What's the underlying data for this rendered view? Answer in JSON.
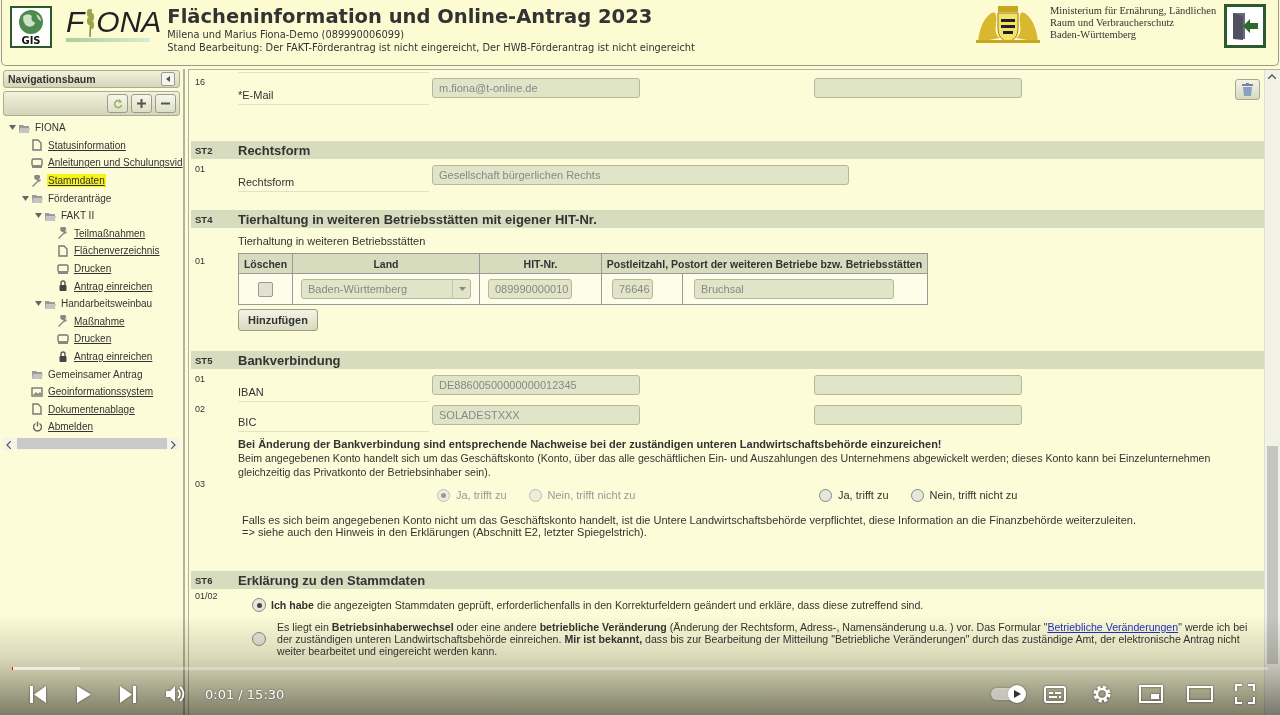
{
  "header": {
    "badge": "GIS",
    "logo": [
      "F",
      "ONA"
    ],
    "title": "Flächeninformation und Online-Antrag 2023",
    "user": "Milena und Marius Fiona-Demo (089990006099)",
    "status": "Stand Bearbeitung: Der FAKT-Förderantrag ist nicht eingereicht, Der HWB-Förderantrag ist nicht eingereicht",
    "ministry": [
      "Ministerium für Ernährung, Ländlichen",
      "Raum und Verbraucherschutz",
      "Baden-Württemberg"
    ]
  },
  "nav": {
    "title": "Navigationsbaum",
    "tree": [
      {
        "label": "FIONA",
        "kind": "folder",
        "expanded": true,
        "selected": false,
        "children": [
          {
            "label": "Statusinformation",
            "kind": "page",
            "selected": false
          },
          {
            "label": "Anleitungen und Schulungsvid",
            "kind": "print",
            "selected": false
          },
          {
            "label": "Stammdaten",
            "kind": "wrench",
            "selected": true
          },
          {
            "label": "Förderanträge",
            "kind": "folder",
            "expanded": true,
            "selected": false,
            "children": [
              {
                "label": "FAKT II",
                "kind": "folder",
                "expanded": true,
                "selected": false,
                "children": [
                  {
                    "label": "Teilmaßnahmen",
                    "kind": "wrench",
                    "selected": false
                  },
                  {
                    "label": "Flächenverzeichnis",
                    "kind": "page",
                    "selected": false
                  },
                  {
                    "label": "Drucken",
                    "kind": "print",
                    "selected": false
                  },
                  {
                    "label": "Antrag einreichen",
                    "kind": "lock",
                    "selected": false
                  }
                ]
              },
              {
                "label": "Handarbeitsweinbau",
                "kind": "folder",
                "expanded": true,
                "selected": false,
                "children": [
                  {
                    "label": "Maßnahme",
                    "kind": "wrench",
                    "selected": false
                  },
                  {
                    "label": "Drucken",
                    "kind": "print",
                    "selected": false
                  },
                  {
                    "label": "Antrag einreichen",
                    "kind": "lock",
                    "selected": false
                  }
                ]
              }
            ]
          },
          {
            "label": "Gemeinsamer Antrag",
            "kind": "folder",
            "selected": false
          },
          {
            "label": "Geoinformationssystem",
            "kind": "map",
            "selected": false
          },
          {
            "label": "Dokumentenablage",
            "kind": "page",
            "selected": false
          },
          {
            "label": "Abmelden",
            "kind": "power",
            "selected": false
          }
        ]
      }
    ]
  },
  "main": {
    "email_row": {
      "kind": "field",
      "number": "16",
      "label": "*E-Mail",
      "value": "m.fiona@t-online.de",
      "correction_field": true
    },
    "sections": [
      {
        "code": "ST2",
        "title": "Rechtsform",
        "rows": [
          {
            "kind": "field",
            "number": "01",
            "label": "Rechtsform",
            "value": "Gesellschaft bürgerlichen Rechts",
            "correction_field": false
          }
        ]
      },
      {
        "code": "ST4",
        "title": "Tierhaltung in weiteren Betriebsstätten mit eigener HIT-Nr.",
        "rows": [
          {
            "kind": "table",
            "number": "01",
            "caption": "Tierhaltung in weiteren Betriebsstätten",
            "columns": [
              "Löschen",
              "Land",
              "HIT-Nr.",
              "Postleitzahl, Postort der weiteren Betriebe bzw. Betriebsstätten"
            ],
            "rows": [
              {
                "checked": false,
                "land": "Baden-Württemberg",
                "hit": "089990000010",
                "plz": "76646",
                "ort": "Bruchsal"
              }
            ],
            "add_button": "Hinzufügen"
          }
        ]
      },
      {
        "code": "ST5",
        "title": "Bankverbindung",
        "rows": [
          {
            "kind": "field",
            "number": "01",
            "label": "IBAN",
            "value": "DE88600500000000012345",
            "correction_field": true
          },
          {
            "kind": "field",
            "number": "02",
            "label": "BIC",
            "value": "SOLADESTXXX",
            "correction_field": true
          },
          {
            "kind": "note",
            "number": "03",
            "warning": "Bei Änderung der Bankverbindung sind entsprechende Nachweise bei der zuständigen unteren Landwirtschaftsbehörde einzureichen!",
            "text": "Beim angegebenen Konto handelt sich um das Geschäftskonto (Konto, über das alle geschäftlichen Ein- und Auszahlungen des Unternehmens abgewickelt werden; dieses Konto kann bei Einzelunternehmen gleichzeitig das Privatkonto der Betriebsinhaber sein).",
            "radio_groups": [
              {
                "disabled": true,
                "options": [
                  {
                    "label": "Ja, trifft zu",
                    "selected": true
                  },
                  {
                    "label": "Nein, trifft nicht zu",
                    "selected": false
                  }
                ]
              },
              {
                "disabled": false,
                "options": [
                  {
                    "label": "Ja, trifft zu",
                    "selected": false
                  },
                  {
                    "label": "Nein, trifft nicht zu",
                    "selected": false
                  }
                ]
              }
            ],
            "hint_lines": [
              "Falls es sich beim angegebenen Konto nicht um das Geschäftskonto handelt, ist die Untere Landwirtschaftsbehörde verpflichtet, diese Information an die Finanzbehörde weiterzuleiten.",
              "=> siehe auch den Hinweis in den Erklärungen (Abschnitt E2, letzter Spiegelstrich)."
            ]
          }
        ]
      },
      {
        "code": "ST6",
        "title": "Erklärung zu den Stammdaten",
        "rows": [
          {
            "kind": "declaration",
            "number": "01/02",
            "options": [
              {
                "text": "**Ich habe** die angezeigten Stammdaten geprüft, erforderlichenfalls in den Korrekturfeldern geändert und erkläre, dass diese zutreffend sind.",
                "selected": true
              },
              {
                "text": "Es liegt ein **Betriebsinhaberwechsel** oder eine andere **betriebliche Veränderung** (Änderung der Rechtsform, Adress-, Namensänderung u.a. ) vor. Das Formular \"",
                "link": "Betriebliche Veränderungen",
                "text_after": "\" werde ich bei der zuständigen unteren Landwirtschaftsbehörde einreichen. **Mir ist bekannt,** dass bis zur Bearbeitung der Mitteilung \"Betriebliche Veränderungen\" durch das zuständige Amt, der elektronische Antrag nicht weiter bearbeitet und eingereicht werden kann.",
                "selected": false
              }
            ]
          }
        ]
      }
    ]
  },
  "player": {
    "time": "0:01 / 15:30",
    "level": 0.001
  }
}
